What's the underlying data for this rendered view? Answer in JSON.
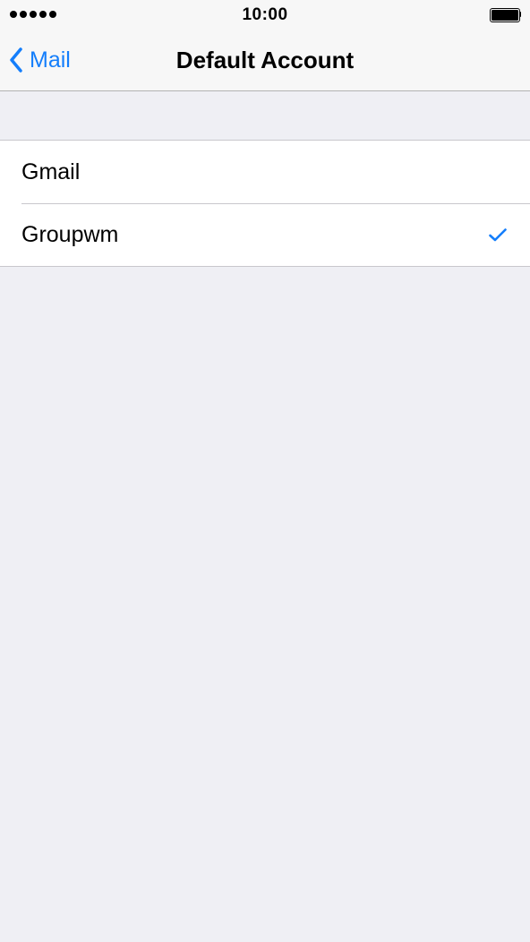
{
  "status_bar": {
    "signal_icon": "signal-dots-icon",
    "time": "10:00",
    "battery_icon": "battery-full-icon"
  },
  "nav": {
    "back_icon": "chevron-left-icon",
    "back_label": "Mail",
    "title": "Default Account"
  },
  "accounts": [
    {
      "label": "Gmail",
      "selected": false
    },
    {
      "label": "Groupwm",
      "selected": true,
      "check_icon": "checkmark-icon"
    }
  ],
  "colors": {
    "accent": "#147efb",
    "background": "#efeff4",
    "bar": "#f7f7f7",
    "separator": "#c8c7cc"
  }
}
